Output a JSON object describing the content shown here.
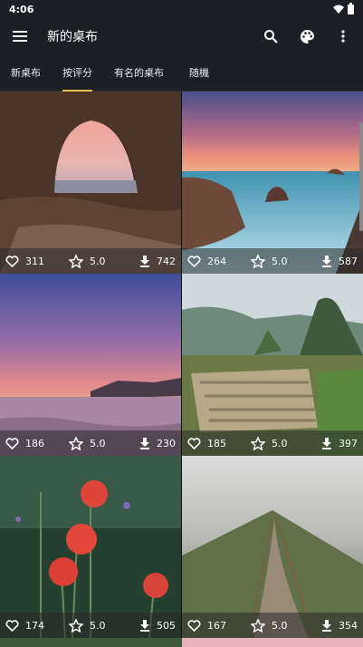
{
  "status": {
    "time": "4:06"
  },
  "app": {
    "title": "新的桌布"
  },
  "tabs": [
    {
      "label": "新桌布",
      "active": false
    },
    {
      "label": "按评分",
      "active": true
    },
    {
      "label": "有名的桌布",
      "active": false
    },
    {
      "label": "随機",
      "active": false
    }
  ],
  "icons": {
    "menu": "menu-icon",
    "search": "search-icon",
    "palette": "palette-icon",
    "more": "more-vert-icon",
    "like": "heart-outline-icon",
    "rating": "star-outline-icon",
    "download": "download-icon"
  },
  "colors": {
    "app_bar": "#1c2026",
    "tab_indicator": "#e6c34c"
  },
  "wallpapers": [
    {
      "scene": "sea-cave",
      "likes": "311",
      "rating": "5.0",
      "downloads": "742"
    },
    {
      "scene": "coastal-cliffs",
      "likes": "264",
      "rating": "5.0",
      "downloads": "587"
    },
    {
      "scene": "purple-sunset-sea",
      "likes": "186",
      "rating": "5.0",
      "downloads": "230"
    },
    {
      "scene": "machu-picchu",
      "likes": "185",
      "rating": "5.0",
      "downloads": "397"
    },
    {
      "scene": "red-poppies",
      "likes": "174",
      "rating": "5.0",
      "downloads": "505"
    },
    {
      "scene": "foggy-path",
      "likes": "167",
      "rating": "5.0",
      "downloads": "354"
    }
  ]
}
